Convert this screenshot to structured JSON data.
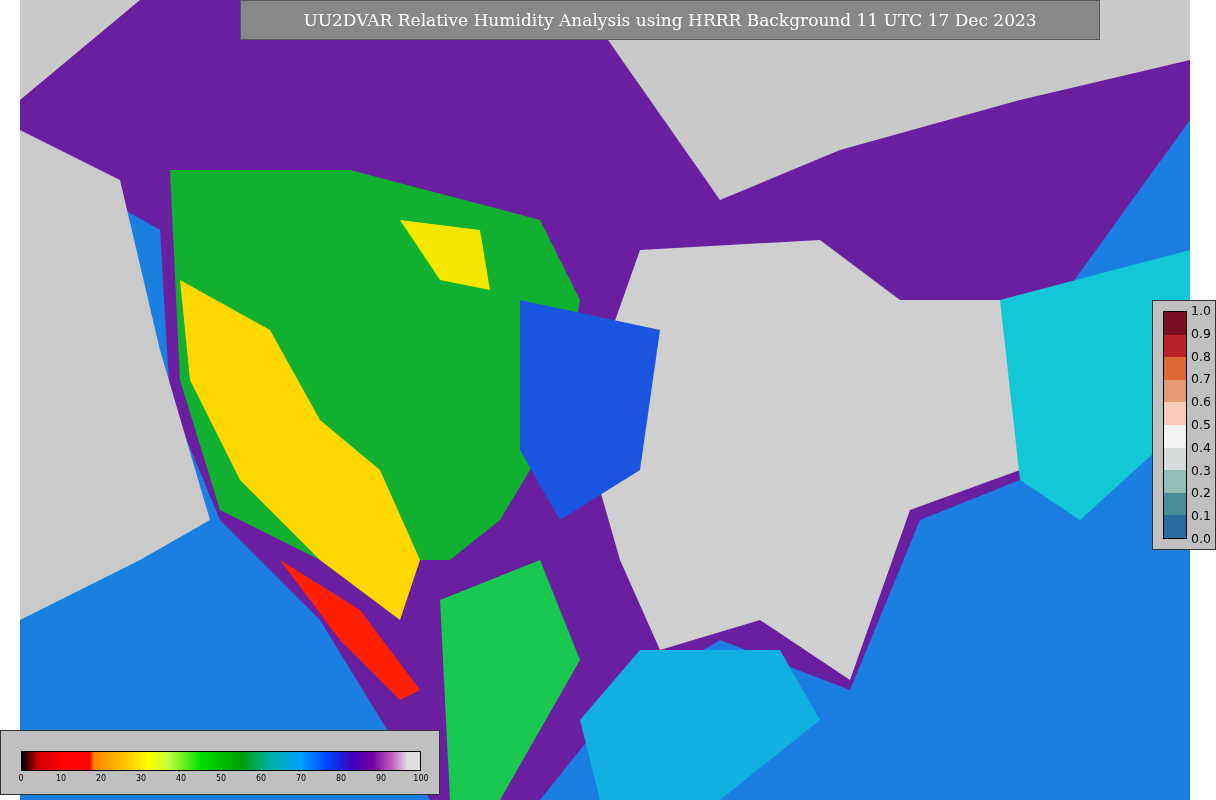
{
  "title": "UU2DVAR Relative Humidity Analysis using HRRR Background 11 UTC 17 Dec 2023",
  "ratio_legend": {
    "ticks": [
      "1.0",
      "0.9",
      "0.8",
      "0.7",
      "0.6",
      "0.5",
      "0.4",
      "0.3",
      "0.2",
      "0.1",
      "0.0"
    ]
  },
  "humidity_legend": {
    "ticks": [
      "0",
      "10",
      "20",
      "30",
      "40",
      "50",
      "60",
      "70",
      "80",
      "90",
      "100"
    ]
  }
}
